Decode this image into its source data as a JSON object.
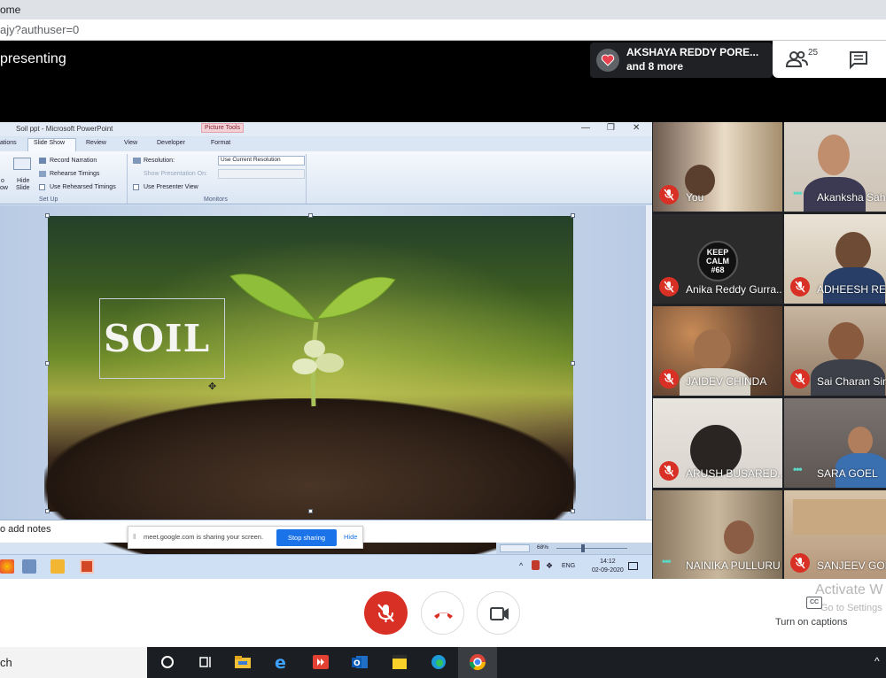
{
  "browser": {
    "tab_text": "ome",
    "url_text": "ajy?authuser=0"
  },
  "meet": {
    "presenting_label": "presenting",
    "notification": {
      "line1": "AKSHAYA REDDY PORE...",
      "line2": "and 8 more"
    },
    "people_count": "25",
    "captions_label": "Turn on captions",
    "cc_icon_text": "CC",
    "activate_line1": "Activate W",
    "activate_line2": "Go to Settings"
  },
  "ppt": {
    "window_title": "Soil ppt - Microsoft PowerPoint",
    "context_tab": "Picture Tools",
    "tabs": [
      "ations",
      "Slide Show",
      "Review",
      "View",
      "Developer",
      "Format"
    ],
    "setup_items": [
      "Record Narration",
      "Rehearse Timings",
      "Use Rehearsed Timings"
    ],
    "hide_slide_label_1": "Hide",
    "hide_slide_label_2": "Slide",
    "left_frag_1": "o",
    "left_frag_2": "ow",
    "group_setup": "Set Up",
    "group_monitors": "Monitors",
    "resolution_label": "Resolution:",
    "resolution_value": "Use Current Resolution",
    "show_on_label": "Show Presentation On:",
    "presenter_view_label": "Use Presenter View",
    "slide_title": "SOIL",
    "notes_placeholder": "o add notes",
    "zoom": "68%",
    "sys_time": "14:12",
    "sys_date": "02-09-2020",
    "sys_lang": "ENG"
  },
  "share_bar": {
    "message": "meet.google.com is sharing your screen.",
    "stop_label": "Stop sharing",
    "hide_label": "Hide"
  },
  "participants": [
    {
      "name": "You",
      "muted": true
    },
    {
      "name": "Akanksha Sah",
      "muted": false
    },
    {
      "name": "Anika Reddy Gurra...",
      "muted": true
    },
    {
      "name": "ADHEESH RED",
      "muted": true
    },
    {
      "name": "JAIDEV CHINDA",
      "muted": true
    },
    {
      "name": "Sai Charan Sin",
      "muted": true
    },
    {
      "name": "ARUSH BUSARED...",
      "muted": true
    },
    {
      "name": "SARA GOEL",
      "muted": false
    },
    {
      "name": "NAINIKA PULLURU",
      "muted": false
    },
    {
      "name": "SANJEEV GOP",
      "muted": true
    }
  ],
  "keep_calm": {
    "line1": "KEEP",
    "line2": "CALM",
    "line3": "#68"
  },
  "taskbar": {
    "search_text": "ch"
  },
  "colors": {
    "mute_red": "#d93025",
    "meet_blue": "#1a73e8",
    "talk_teal": "#5bd8c5"
  }
}
